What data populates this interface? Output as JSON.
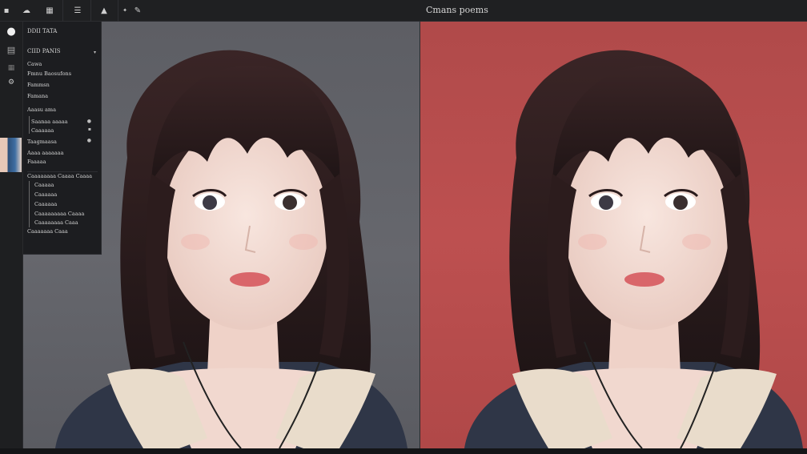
{
  "window_title": "Cmans poems",
  "toolbar": {
    "items": [
      {
        "name": "menu-icon",
        "glyph": "▪"
      },
      {
        "name": "cloud-icon",
        "glyph": "☁"
      },
      {
        "name": "layout-icon",
        "glyph": "▦"
      },
      {
        "name": "layers-icon",
        "glyph": "☰"
      },
      {
        "name": "mountain-icon",
        "glyph": "▲"
      },
      {
        "name": "sparkle-icon",
        "glyph": "✦"
      },
      {
        "name": "pen-icon",
        "glyph": "✎"
      }
    ]
  },
  "toolstrip": {
    "items": [
      {
        "name": "circle-tool-icon",
        "glyph": "●"
      },
      {
        "name": "document-icon",
        "glyph": "▤"
      },
      {
        "name": "grid-icon",
        "glyph": "▦"
      },
      {
        "name": "settings-icon",
        "glyph": "⚙"
      }
    ]
  },
  "panel": {
    "title": "DDII TATA",
    "dropdown": "CIID PANIS",
    "rows": [
      "Cawa",
      "Fmnu Baosufons",
      "Fammsn",
      "Famana",
      "Aaasu ama",
      "Saanaa aaaaa",
      "Caaaaaa",
      "Taagmaasa",
      "Aaaa aaaaaaa",
      "Faaaaa",
      "Caaaaaaaa Caaaa Caaaa",
      "Caaaaa",
      "Caaaaaa",
      "Caaaaaa",
      "Caaaaaaaaa Caaaa",
      "Caaaaaaaa Caaa",
      "Caaaaaaa Caaa"
    ]
  },
  "colors": {
    "left_background": "#63646a",
    "right_background": "#b84c4c",
    "hair": "#2a1b1c",
    "sweater": "#2f3647",
    "lace": "#e9dccb",
    "skin": "#f3dcd5"
  }
}
